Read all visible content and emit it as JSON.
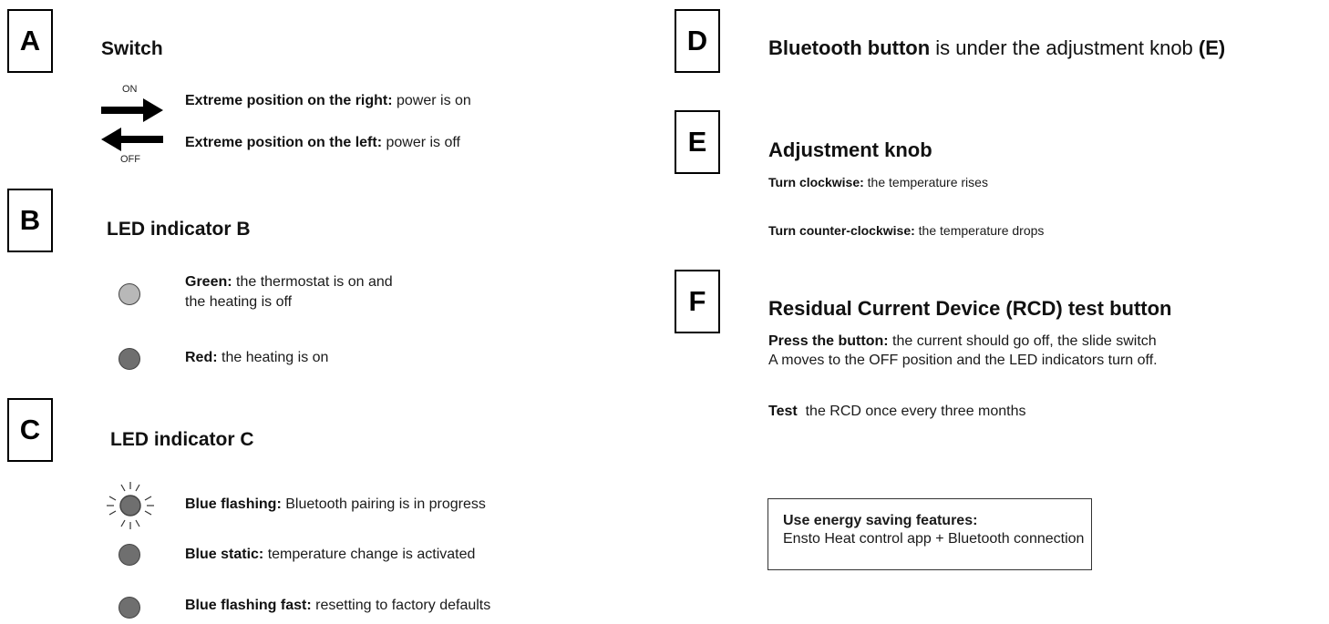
{
  "sections": {
    "a": {
      "letter": "A",
      "title": "Switch",
      "on_label": "ON",
      "off_label": "OFF",
      "right_bold": "Extreme position on the right:",
      "right_text": " power is on",
      "left_bold": "Extreme position on the left:",
      "left_text": " power is off"
    },
    "b": {
      "letter": "B",
      "title": "LED indicator B",
      "green_bold": "Green:",
      "green_text": " the thermostat is on and",
      "green_text2": "the heating is off",
      "red_bold": "Red:",
      "red_text": " the heating is on"
    },
    "c": {
      "letter": "C",
      "title": "LED indicator C",
      "flash_bold": "Blue flashing:",
      "flash_text": " Bluetooth pairing is in progress",
      "static_bold": "Blue static:",
      "static_text": " temperature change is activated",
      "fast_bold": "Blue flashing fast:",
      "fast_text": " resetting to factory defaults"
    },
    "d": {
      "letter": "D",
      "bold": "Bluetooth button",
      "text": " is under the adjustment knob ",
      "bold2": "(E)"
    },
    "e": {
      "letter": "E",
      "title": "Adjustment knob",
      "cw_bold": "Turn clockwise:",
      "cw_text": " the temperature rises",
      "ccw_bold": "Turn counter-clockwise:",
      "ccw_text": " the temperature drops"
    },
    "f": {
      "letter": "F",
      "title": "Residual Current Device (RCD) test button",
      "press_bold": "Press the button:",
      "press_text": " the current should go off, the slide switch",
      "press_text2": "A moves to the OFF position and the LED indicators turn off.",
      "test_bold": "Test",
      "test_text": "  the RCD once every three months"
    }
  },
  "notice": {
    "title": "Use energy saving features:",
    "text": "Ensto Heat control app + Bluetooth connection"
  }
}
